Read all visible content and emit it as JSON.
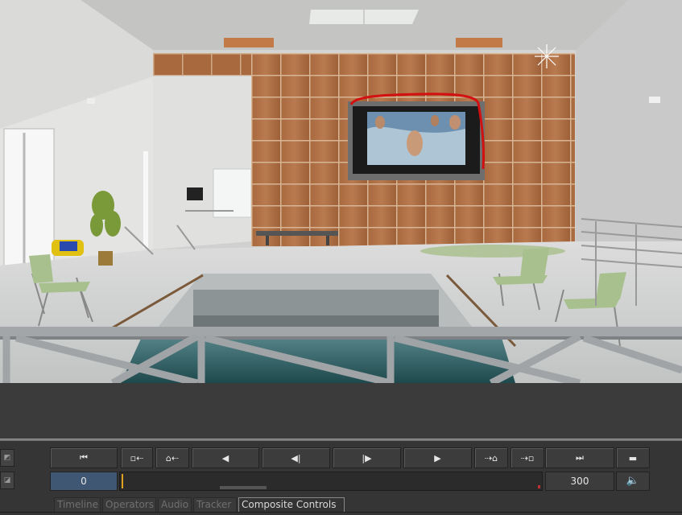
{
  "viewport": {
    "description_icon": "3d-render-viewport"
  },
  "transport": {
    "buttons": [
      {
        "name": "go-to-start-button",
        "icon": "go-to-start-icon",
        "glyph": "⏮"
      },
      {
        "name": "step-key-back-button",
        "icon": "prev-key-icon",
        "glyph": "▫⇠"
      },
      {
        "name": "prev-keyframe-button",
        "icon": "prev-keyframe-icon",
        "glyph": "⌂⇠"
      },
      {
        "name": "play-reverse-button",
        "icon": "play-reverse-icon",
        "glyph": "◀"
      },
      {
        "name": "step-back-button",
        "icon": "step-back-icon",
        "glyph": "◀|"
      },
      {
        "name": "step-forward-button",
        "icon": "step-forward-icon",
        "glyph": "|▶"
      },
      {
        "name": "play-button",
        "icon": "play-icon",
        "glyph": "▶"
      },
      {
        "name": "next-keyframe-button",
        "icon": "next-keyframe-icon",
        "glyph": "⇢⌂"
      },
      {
        "name": "step-key-forward-button",
        "icon": "next-key-icon",
        "glyph": "⇢▫"
      },
      {
        "name": "go-to-end-button",
        "icon": "go-to-end-icon",
        "glyph": "⏭"
      },
      {
        "name": "loop-mode-button",
        "icon": "loop-icon",
        "glyph": "▬"
      }
    ],
    "current_frame": "0",
    "end_frame": "300",
    "volume_icon": "🔈"
  },
  "tabs": [
    {
      "label": "Timeline",
      "active": false
    },
    {
      "label": "Operators",
      "active": false
    },
    {
      "label": "Audio",
      "active": false
    },
    {
      "label": "Tracker",
      "active": false
    },
    {
      "label": "Composite Controls",
      "active": true
    }
  ],
  "colors": {
    "panel": "#353535",
    "frame_field": "#3f5772",
    "annotation_red": "#d21010",
    "playhead": "#e0a020"
  }
}
